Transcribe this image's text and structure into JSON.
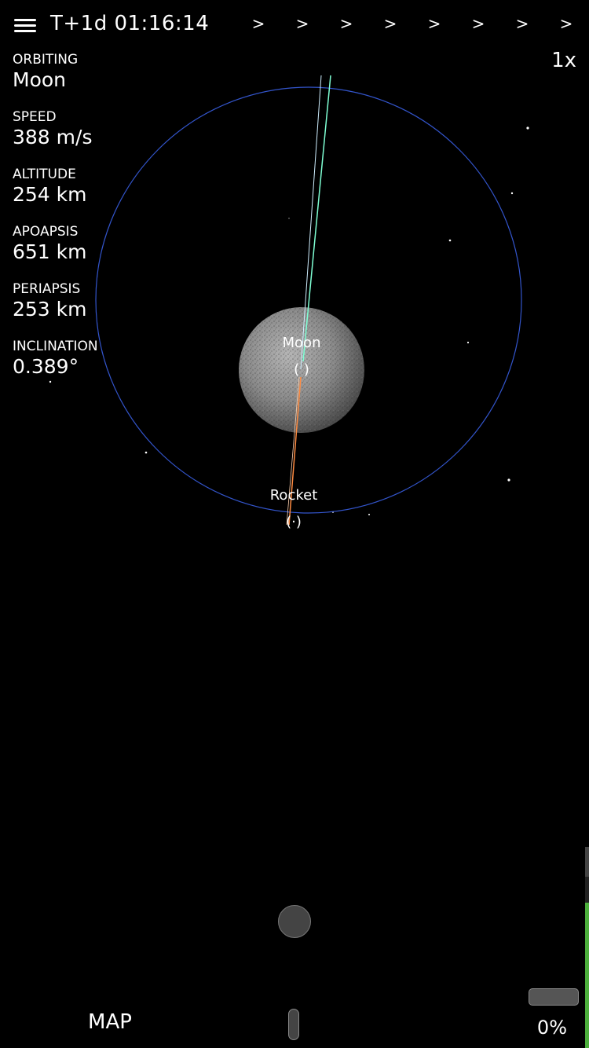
{
  "header": {
    "mission_time": "T+1d 01:16:14",
    "warp_arrows": [
      ">",
      ">",
      ">",
      ">",
      ">",
      ">",
      ">",
      ">"
    ],
    "time_scale": "1x"
  },
  "stats": [
    {
      "label": "ORBITING",
      "value": "Moon"
    },
    {
      "label": "SPEED",
      "value": "388 m/s"
    },
    {
      "label": "ALTITUDE",
      "value": "254 km"
    },
    {
      "label": "APOAPSIS",
      "value": "651 km"
    },
    {
      "label": "PERIAPSIS",
      "value": "253 km"
    },
    {
      "label": "INCLINATION",
      "value": "0.389°"
    }
  ],
  "map": {
    "moon_label": "Moon",
    "rocket_label": "Rocket",
    "moon_marker": "( )",
    "rocket_marker": "(·)",
    "colors": {
      "orbit": "#3355cc",
      "velocity_line": "#7fffd4",
      "retro_line": "#ff8c42",
      "moon_surface": "#8a8a8a"
    }
  },
  "controls": {
    "map_label": "MAP",
    "fuel_percent": "0%",
    "fuel_level": 0,
    "throttle_level": 0.85,
    "throttle_color": "#4caf3c"
  }
}
